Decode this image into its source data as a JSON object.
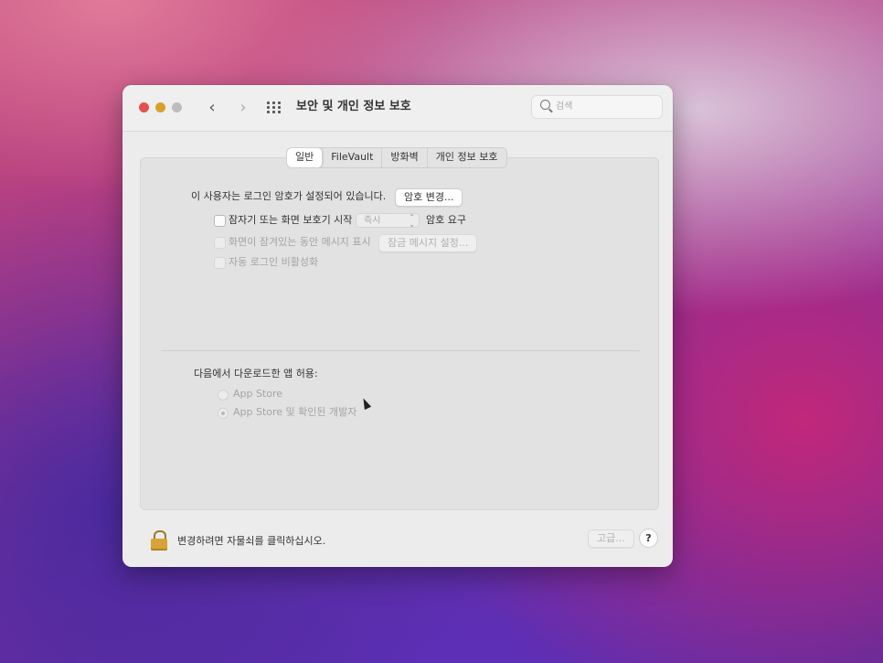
{
  "window": {
    "title": "보안 및 개인 정보 보호",
    "search_placeholder": "검색"
  },
  "tabs": [
    "일반",
    "FileVault",
    "방화벽",
    "개인 정보 보호"
  ],
  "general": {
    "password_text": "이 사용자는 로그인 암호가 설정되어 있습니다.",
    "change_password_button": "암호 변경...",
    "require_password_label": "잠자기 또는 화면 보호기 시작",
    "require_password_select": "즉시",
    "require_password_suffix": "암호 요구",
    "show_message_label": "화면이 잠겨있는 동안 메시지 표시",
    "lock_message_button": "잠금 메시지 설정...",
    "disable_autologin_label": "자동 로그인 비활성화",
    "allow_apps_label": "다음에서 다운로드한 앱 허용:",
    "radio_app_store": "App Store",
    "radio_app_store_devs": "App Store 및 확인된 개발자"
  },
  "footer": {
    "lock_text": "변경하려면 자물쇠를 클릭하십시오.",
    "advanced_button": "고급...",
    "help_label": "?"
  },
  "icons": {
    "back": "‹",
    "forward": "›",
    "select_arrows": "⌃⌄"
  }
}
